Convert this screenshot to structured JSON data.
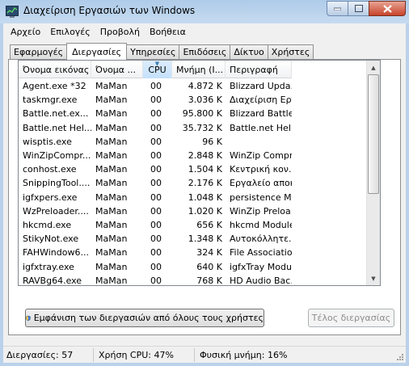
{
  "window": {
    "title": "Διαχείριση Εργασιών των Windows"
  },
  "menu": [
    "Αρχείο",
    "Επιλογές",
    "Προβολή",
    "Βοήθεια"
  ],
  "tabs": [
    {
      "label": "Εφαρμογές"
    },
    {
      "label": "Διεργασίες"
    },
    {
      "label": "Υπηρεσίες"
    },
    {
      "label": "Επιδόσεις"
    },
    {
      "label": "Δίκτυο"
    },
    {
      "label": "Χρήστες"
    }
  ],
  "active_tab": "Διεργασίες",
  "columns": [
    "Όνομα εικόνας",
    "Όνομα ...",
    "CPU",
    "Μνήμη (Ι...",
    "Περιγραφή"
  ],
  "processes": [
    {
      "name": "Agent.exe *32",
      "user": "MaMan",
      "cpu": "00",
      "mem": "4.872 K",
      "desc": "Blizzard Upda..."
    },
    {
      "name": "taskmgr.exe",
      "user": "MaMan",
      "cpu": "00",
      "mem": "3.036 K",
      "desc": "Διαχείριση Εργ..."
    },
    {
      "name": "Battle.net.ex...",
      "user": "MaMan",
      "cpu": "00",
      "mem": "95.800 K",
      "desc": "Blizzard Battle..."
    },
    {
      "name": "Battle.net Hel...",
      "user": "MaMan",
      "cpu": "00",
      "mem": "35.732 K",
      "desc": "Battle.net Hel..."
    },
    {
      "name": "wisptis.exe",
      "user": "MaMan",
      "cpu": "00",
      "mem": "96 K",
      "desc": ""
    },
    {
      "name": "WinZipCompr...",
      "user": "MaMan",
      "cpu": "00",
      "mem": "2.848 K",
      "desc": "WinZip Compr..."
    },
    {
      "name": "conhost.exe",
      "user": "MaMan",
      "cpu": "00",
      "mem": "1.504 K",
      "desc": "Κεντρική κον..."
    },
    {
      "name": "SnippingTool....",
      "user": "MaMan",
      "cpu": "00",
      "mem": "2.176 K",
      "desc": "Εργαλείο αποκ..."
    },
    {
      "name": "igfxpers.exe",
      "user": "MaMan",
      "cpu": "00",
      "mem": "1.048 K",
      "desc": "persistence M..."
    },
    {
      "name": "WzPreloader....",
      "user": "MaMan",
      "cpu": "00",
      "mem": "1.020 K",
      "desc": "WinZip Preloa..."
    },
    {
      "name": "hkcmd.exe",
      "user": "MaMan",
      "cpu": "00",
      "mem": "656 K",
      "desc": "hkcmd Module"
    },
    {
      "name": "StikyNot.exe",
      "user": "MaMan",
      "cpu": "00",
      "mem": "1.348 K",
      "desc": "Αυτοκόλλητε..."
    },
    {
      "name": "FAHWindow6...",
      "user": "MaMan",
      "cpu": "00",
      "mem": "324 K",
      "desc": "File Associatio..."
    },
    {
      "name": "igfxtray.exe",
      "user": "MaMan",
      "cpu": "00",
      "mem": "640 K",
      "desc": "igfxTray Module"
    },
    {
      "name": "RAVBg64.exe",
      "user": "MaMan",
      "cpu": "00",
      "mem": "768 K",
      "desc": "HD Audio Bac..."
    }
  ],
  "buttons": {
    "show_all": "Εμφάνιση των διεργασιών από όλους τους χρήστες",
    "end_process": "Τέλος διεργασίας"
  },
  "status": {
    "processes": "Διεργασίες: 57",
    "cpu": "Χρήση CPU: 47%",
    "memory": "Φυσική μνήμη: 16%"
  }
}
